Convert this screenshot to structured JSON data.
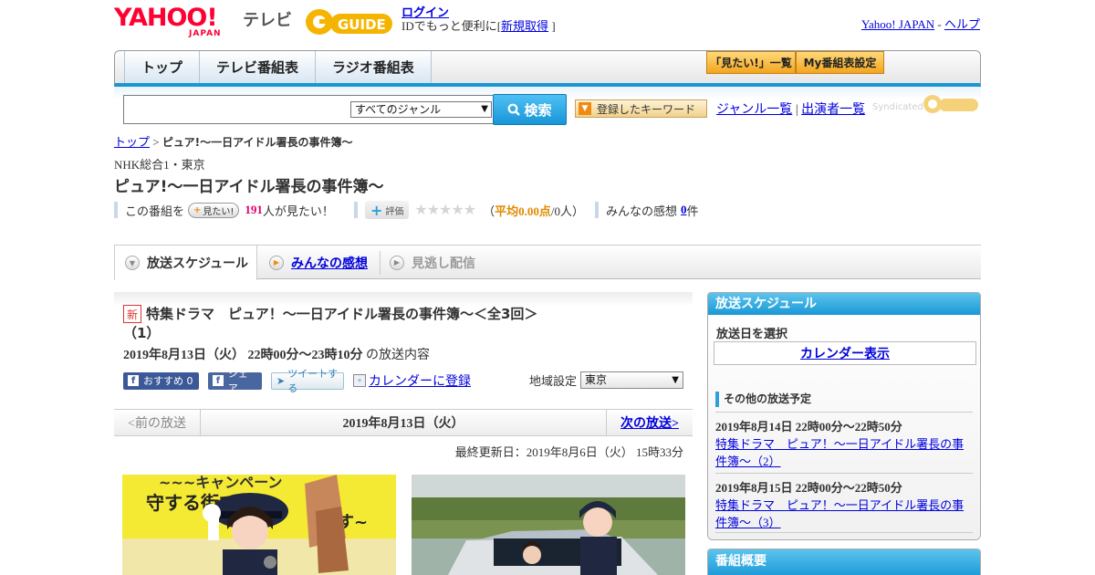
{
  "header": {
    "logo_yahoo": "YAHOO!",
    "logo_japan": "JAPAN",
    "logo_tv": "テレビ",
    "logo_gguide": "GUIDE",
    "login_link": "ログイン",
    "login_text": "IDでもっと便利に[",
    "signup_link": "新規取得",
    "signup_close": "]",
    "yahoo_japan_link": "Yahoo! JAPAN",
    "separator": "-",
    "help_link": "ヘルプ"
  },
  "nav": {
    "tabs": [
      "トップ",
      "テレビ番組表",
      "ラジオ番組表"
    ],
    "mitai_list": "「見たい!」一覧",
    "my_settings": "My番組表設定"
  },
  "search": {
    "input_value": "",
    "genre_selected": "すべてのジャンル",
    "search_button": "検索",
    "keyword_button": "登録したキーワード",
    "genre_list_link": "ジャンル一覧",
    "divider": "|",
    "performer_list_link": "出演者一覧",
    "syndicated": "Syndicated"
  },
  "breadcrumb": {
    "top": "トップ",
    "sep": ">",
    "current": "ピュア!～一日アイドル署長の事件簿～"
  },
  "program": {
    "channel": "NHK総合1・東京",
    "title": "ピュア!～一日アイドル署長の事件簿～",
    "mitai_prefix": "この番組を",
    "mitai_button": "見たい!",
    "mitai_count": "191",
    "mitai_suffix": "人が見たい！",
    "rating_button": "評価",
    "rating_value": 0,
    "rating_open": "（",
    "rating_avg": "平均0.00点",
    "rating_people": "/0人）",
    "comments_label": "みんなの感想",
    "comments_count": "0",
    "comments_unit": "件"
  },
  "subtabs": {
    "schedule": "放送スケジュール",
    "comments": "みんなの感想",
    "streaming": "見逃し配信"
  },
  "episode": {
    "new_badge": "新",
    "title": "特集ドラマ　ピュア！～一日アイドル署長の事件簿～＜全3回＞（1）",
    "datetime": "2019年8月13日（火） 22時00分～23時10分",
    "datetime_suffix": "の放送内容",
    "share_fb_recommend": "おすすめ 0",
    "share_fb": "シェア",
    "share_tweet": "ツイートする",
    "calendar_link": "カレンダーに登録",
    "region_label": "地域設定",
    "region_selected": "東京"
  },
  "pager": {
    "prev": "<前の放送",
    "current": "2019年8月13日（火）",
    "next": "次の放送>"
  },
  "updated": "最終更新日：2019年8月6日（火） 15時33分",
  "sidebar": {
    "schedule_header": "放送スケジュール",
    "select_date": "放送日を選択",
    "calendar_button": "カレンダー表示",
    "other_label": "その他の放送予定",
    "items": [
      {
        "datetime": "2019年8月14日 22時00分～22時50分",
        "title": "特集ドラマ　ピュア！～一日アイドル署長の事件簿～（2）"
      },
      {
        "datetime": "2019年8月15日 22時00分～22時50分",
        "title": "特集ドラマ　ピュア！～一日アイドル署長の事件簿～（3）"
      }
    ],
    "overview_header": "番組概要"
  },
  "photos": {
    "photo1_banner": "~~~キャンペーン",
    "photo1_text": "守する街で",
    "photo1_text2": "ます~"
  },
  "colors": {
    "accent_blue": "#1a96d4",
    "yahoo_red": "#ff0033",
    "gguide_yellow": "#f5b400",
    "link": "#0000de"
  }
}
